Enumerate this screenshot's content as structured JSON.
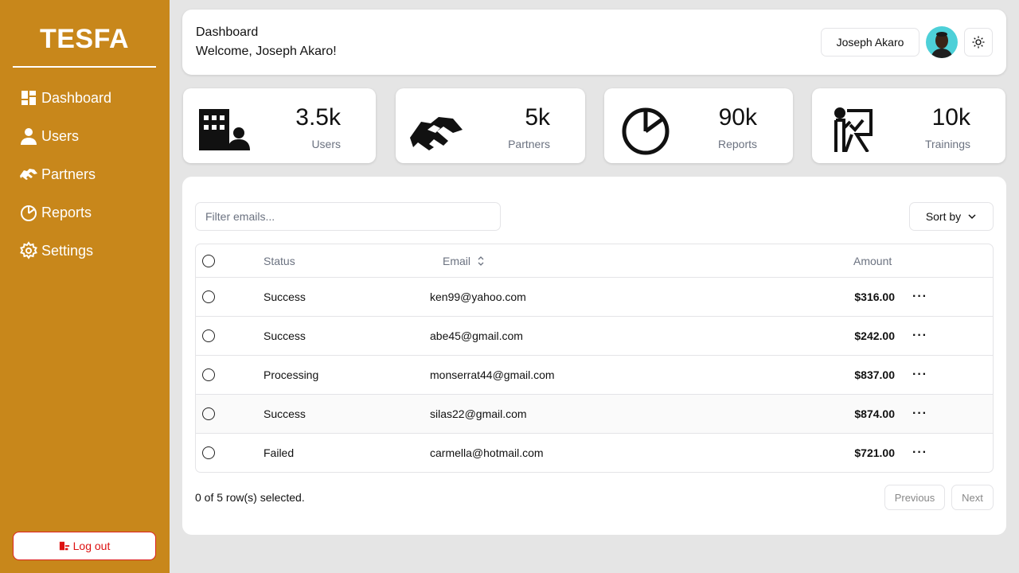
{
  "sidebar": {
    "brand": "TESFA",
    "items": [
      {
        "label": "Dashboard",
        "icon": "dashboard-icon"
      },
      {
        "label": "Users",
        "icon": "user-icon"
      },
      {
        "label": "Partners",
        "icon": "handshake-icon"
      },
      {
        "label": "Reports",
        "icon": "pie-chart-icon"
      },
      {
        "label": "Settings",
        "icon": "gear-icon"
      }
    ],
    "logout_label": "Log out"
  },
  "header": {
    "title": "Dashboard",
    "welcome": "Welcome, Joseph Akaro!",
    "user_name": "Joseph Akaro"
  },
  "stats": [
    {
      "value": "3.5k",
      "label": "Users",
      "icon": "building-user-icon"
    },
    {
      "value": "5k",
      "label": "Partners",
      "icon": "handshake-icon"
    },
    {
      "value": "90k",
      "label": "Reports",
      "icon": "pie-chart-icon"
    },
    {
      "value": "10k",
      "label": "Trainings",
      "icon": "training-icon"
    }
  ],
  "table": {
    "filter_placeholder": "Filter emails...",
    "sort_label": "Sort by",
    "columns": {
      "status": "Status",
      "email": "Email",
      "amount": "Amount"
    },
    "rows": [
      {
        "status": "Success",
        "email": "ken99@yahoo.com",
        "amount": "$316.00"
      },
      {
        "status": "Success",
        "email": "abe45@gmail.com",
        "amount": "$242.00"
      },
      {
        "status": "Processing",
        "email": "monserrat44@gmail.com",
        "amount": "$837.00"
      },
      {
        "status": "Success",
        "email": "silas22@gmail.com",
        "amount": "$874.00"
      },
      {
        "status": "Failed",
        "email": "carmella@hotmail.com",
        "amount": "$721.00"
      }
    ],
    "selection_text": "0 of 5 row(s) selected.",
    "previous_label": "Previous",
    "next_label": "Next",
    "row_menu": "···"
  },
  "colors": {
    "sidebar": "#c8871b",
    "logout": "#dd1111",
    "avatar_bg": "#4dd0d8"
  }
}
